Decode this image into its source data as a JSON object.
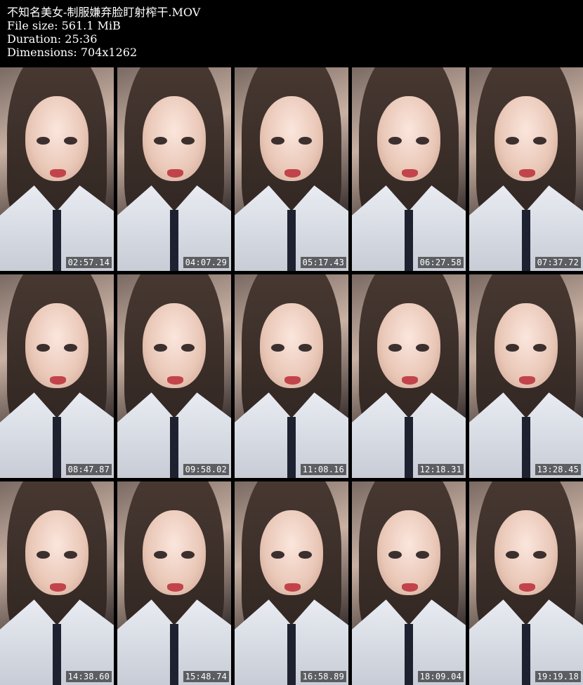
{
  "info": {
    "title": "不知名美女-制服嫌弃脸盯射榨干.MOV",
    "file_size": "File size: 561.1 MiB",
    "duration": "Duration: 25:36",
    "dimensions": "Dimensions: 704x1262"
  },
  "thumbnails": [
    {
      "timestamp": "02:57.14"
    },
    {
      "timestamp": "04:07.29"
    },
    {
      "timestamp": "05:17.43"
    },
    {
      "timestamp": "06:27.58"
    },
    {
      "timestamp": "07:37.72"
    },
    {
      "timestamp": "08:47.87"
    },
    {
      "timestamp": "09:58.02"
    },
    {
      "timestamp": "11:08.16"
    },
    {
      "timestamp": "12:18.31"
    },
    {
      "timestamp": "13:28.45"
    },
    {
      "timestamp": "14:38.60"
    },
    {
      "timestamp": "15:48.74"
    },
    {
      "timestamp": "16:58.89"
    },
    {
      "timestamp": "18:09.04"
    },
    {
      "timestamp": "19:19.18"
    }
  ]
}
